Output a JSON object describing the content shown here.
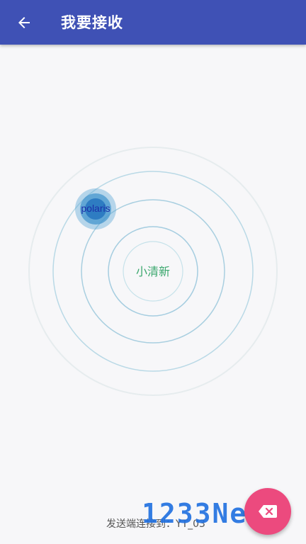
{
  "header": {
    "title": "我要接收"
  },
  "radar": {
    "center_label": "小清新",
    "devices": [
      {
        "label": "polaris"
      }
    ]
  },
  "status": {
    "text": "发送端连接到：YT_03"
  },
  "watermark": {
    "text": "1233News"
  },
  "icons": {
    "back": "arrow-left-icon",
    "fab": "backspace-icon"
  },
  "colors": {
    "app_bar": "#3f51b5",
    "fab": "#ec4a7e",
    "center_label": "#3aa76d",
    "device_label": "#1b2fa8",
    "watermark": "#1e6fe0"
  }
}
